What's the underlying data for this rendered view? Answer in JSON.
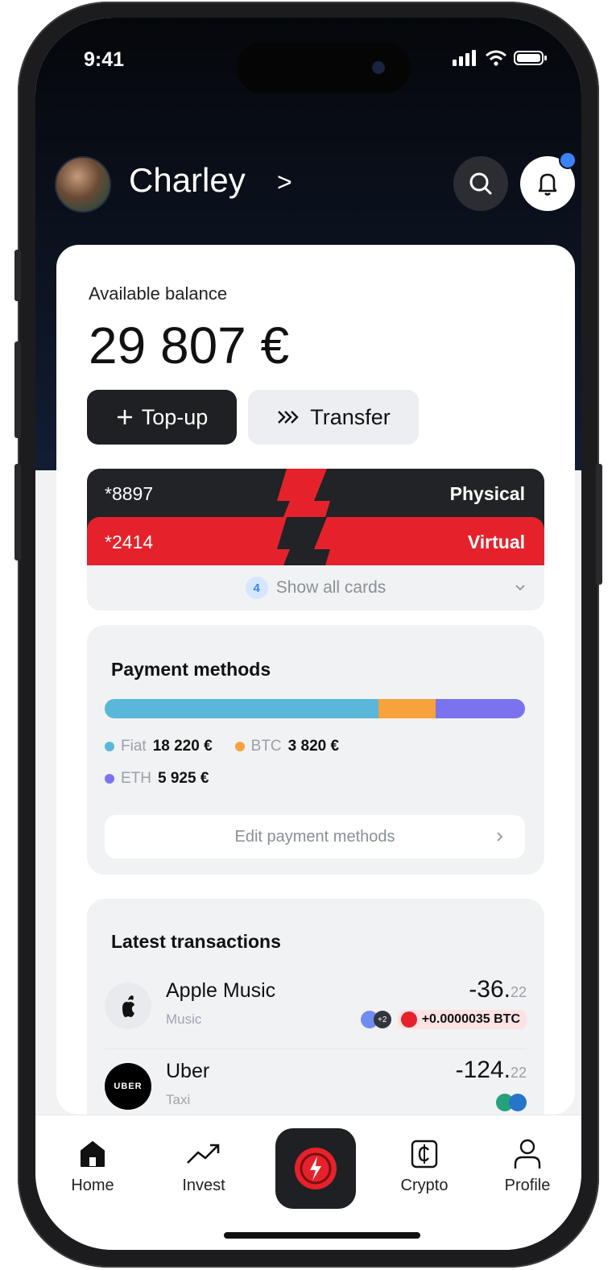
{
  "status_bar": {
    "time": "9:41"
  },
  "header": {
    "user_name": "Charley",
    "name_chevron": ">"
  },
  "balance": {
    "label": "Available balance",
    "amount": "29 807 €",
    "topup_label": "Top-up",
    "transfer_label": "Transfer"
  },
  "cards": {
    "physical": {
      "number": "*8897",
      "type": "Physical"
    },
    "virtual": {
      "number": "*2414",
      "type": "Virtual"
    },
    "count": "4",
    "show_all_label": "Show all cards"
  },
  "payment_methods": {
    "title": "Payment methods",
    "items": [
      {
        "name": "Fiat",
        "amount": "18 220 €",
        "value": 18220,
        "color": "#5ab7d9"
      },
      {
        "name": "BTC",
        "amount": "3 820 €",
        "value": 3820,
        "color": "#f7a23b"
      },
      {
        "name": "ETH",
        "amount": "5 925 €",
        "value": 5925,
        "color": "#7b72f0"
      }
    ],
    "edit_label": "Edit payment methods"
  },
  "transactions": {
    "title": "Latest transactions",
    "items": [
      {
        "name": "Apple Music",
        "category": "Music",
        "amount_main": "-36.",
        "amount_cents": "22",
        "extra_count": "+2",
        "crypto_note": "+0.0000035 BTC"
      },
      {
        "name": "Uber",
        "category": "Taxi",
        "amount_main": "-124.",
        "amount_cents": "22",
        "logo_text": "UBER"
      }
    ]
  },
  "nav": {
    "items": [
      {
        "label": "Home",
        "icon": "home-icon"
      },
      {
        "label": "Invest",
        "icon": "trend-icon"
      },
      {
        "label": "Crypto",
        "icon": "crypto-icon"
      },
      {
        "label": "Profile",
        "icon": "profile-icon"
      }
    ]
  },
  "colors": {
    "accent": "#e5222b",
    "dark": "#1f2024",
    "notification": "#3b82f6"
  }
}
